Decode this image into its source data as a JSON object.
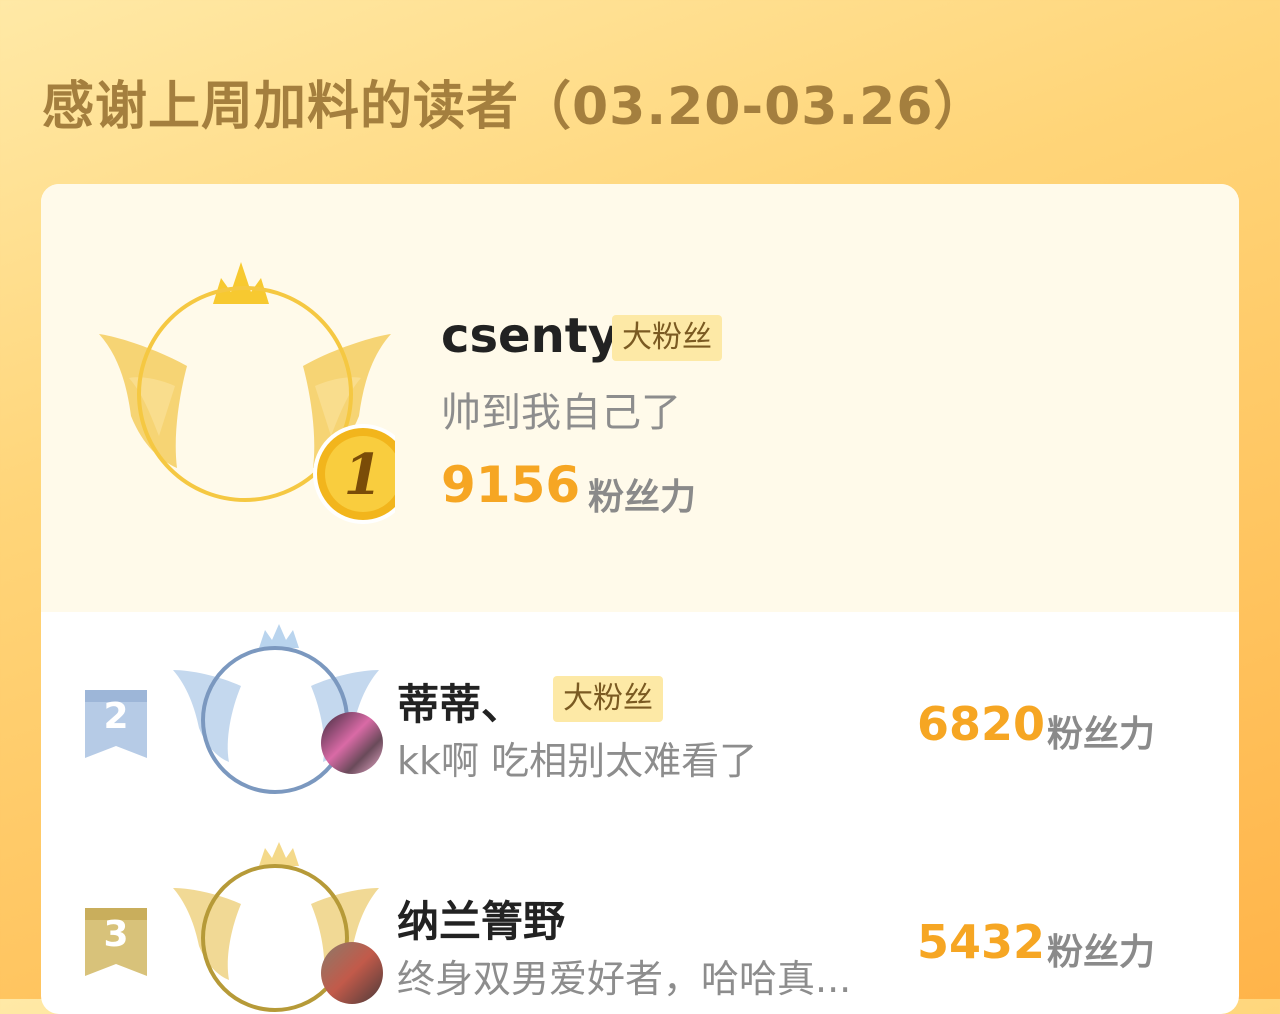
{
  "page": {
    "title": "感谢上周加料的读者（03.20-03.26）"
  },
  "readers": [
    {
      "rank": "1",
      "name": "csenty",
      "tag": "大粉丝",
      "message": "帅到我自己了",
      "score": "9156",
      "score_unit": "粉丝力"
    },
    {
      "rank": "2",
      "name": "蒂蒂、",
      "tag": "大粉丝",
      "message": "kk啊 吃相别太难看了",
      "score": "6820",
      "score_unit": "粉丝力"
    },
    {
      "rank": "3",
      "name": "纳兰箐野",
      "tag": "",
      "message": "终身双男爱好者，哈哈真...",
      "score": "5432",
      "score_unit": "粉丝力"
    }
  ],
  "colors": {
    "accent": "#f6a623",
    "tag_bg": "#fde9a6",
    "gold_frame": "#f5c842",
    "silver_frame": "#7b98bf",
    "bronze_frame": "#b69a38"
  }
}
